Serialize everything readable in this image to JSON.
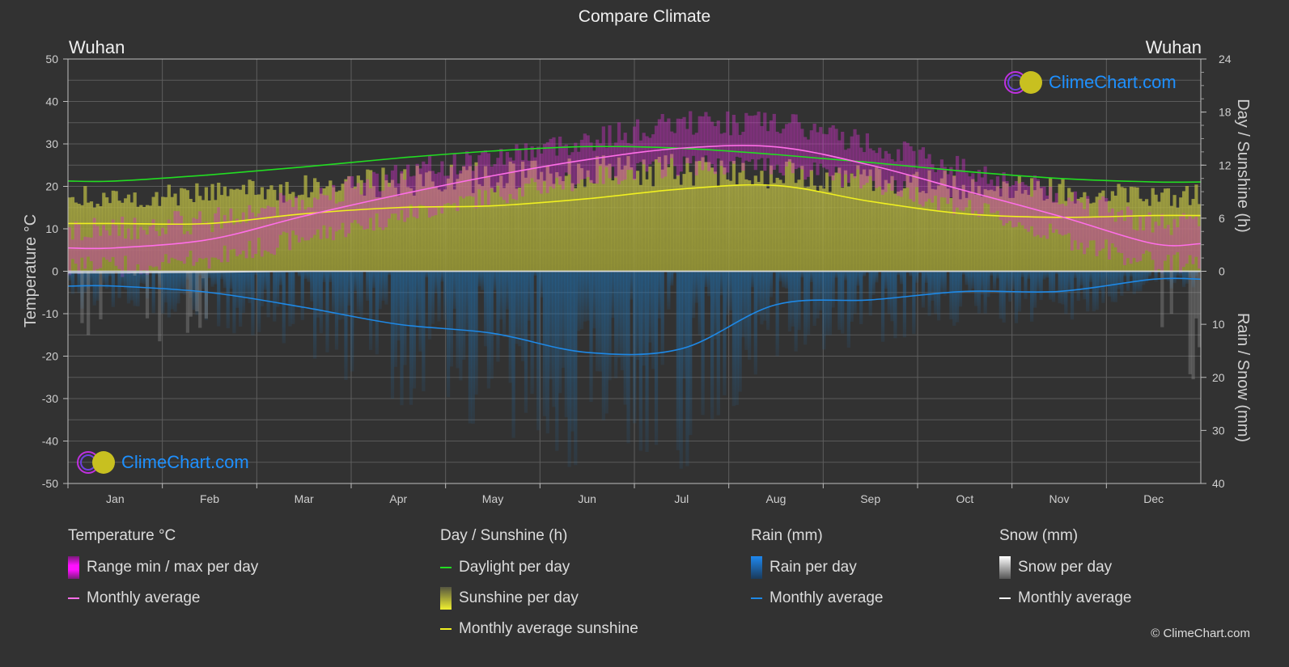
{
  "title": "Compare Climate",
  "city_left": "Wuhan",
  "city_right": "Wuhan",
  "logo_text": "ClimeChart.com",
  "copyright": "© ClimeChart.com",
  "colors": {
    "background": "#323232",
    "temperature_range": "#e020e0",
    "temperature_avg": "#ff6ee8",
    "daylight": "#22dd22",
    "sunshine_bar": "#c8c832",
    "sunshine_avg": "#f0f020",
    "rain_bar": "#1f6fae",
    "rain_avg": "#1e88e5",
    "snow_bar": "#9a9a9a",
    "snow_avg": "#ffffff",
    "logo_text": "#1e90ff"
  },
  "legend": {
    "temperature": {
      "title": "Temperature °C",
      "range": "Range min / max per day",
      "avg": "Monthly average"
    },
    "sunshine": {
      "title": "Day / Sunshine (h)",
      "daylight": "Daylight per day",
      "sunshine": "Sunshine per day",
      "avg": "Monthly average sunshine"
    },
    "rain": {
      "title": "Rain (mm)",
      "per_day": "Rain per day",
      "avg": "Monthly average"
    },
    "snow": {
      "title": "Snow (mm)",
      "per_day": "Snow per day",
      "avg": "Monthly average"
    }
  },
  "chart_data": {
    "type": "line",
    "title": "Compare Climate",
    "categories": [
      "Jan",
      "Feb",
      "Mar",
      "Apr",
      "May",
      "Jun",
      "Jul",
      "Aug",
      "Sep",
      "Oct",
      "Nov",
      "Dec"
    ],
    "left_axis": {
      "label": "Temperature °C",
      "range": [
        -50,
        50
      ],
      "ticks": [
        50,
        40,
        30,
        20,
        10,
        0,
        -10,
        -20,
        -30,
        -40,
        -50
      ]
    },
    "right_axis_top": {
      "label": "Day / Sunshine (h)",
      "range": [
        0,
        24
      ],
      "ticks": [
        24,
        18,
        12,
        6,
        0
      ]
    },
    "right_axis_bottom": {
      "label": "Rain / Snow (mm)",
      "range": [
        0,
        40
      ],
      "ticks": [
        0,
        10,
        20,
        30,
        40
      ]
    },
    "grid": true,
    "legend_position": "bottom",
    "series": [
      {
        "name": "Temperature monthly average",
        "axis": "temperature",
        "unit": "°C",
        "values": [
          5.5,
          7.5,
          13,
          18,
          22.5,
          26.3,
          29,
          29.3,
          25,
          19,
          13,
          6.5
        ]
      },
      {
        "name": "Temperature daily max (approx)",
        "axis": "temperature",
        "unit": "°C",
        "values": [
          10,
          12,
          17,
          23,
          27,
          31,
          35,
          35,
          30,
          24,
          18,
          11
        ]
      },
      {
        "name": "Temperature daily min (approx)",
        "axis": "temperature",
        "unit": "°C",
        "values": [
          1,
          3,
          8,
          13,
          18,
          22,
          25,
          25,
          21,
          15,
          8,
          2
        ]
      },
      {
        "name": "Daylight per day",
        "axis": "sunshine",
        "unit": "h",
        "values": [
          10.2,
          10.9,
          11.8,
          12.8,
          13.6,
          14.1,
          13.9,
          13.2,
          12.3,
          11.3,
          10.5,
          10.1
        ]
      },
      {
        "name": "Sunshine per day (approx)",
        "axis": "sunshine",
        "unit": "h",
        "values": [
          9.3,
          9.8,
          10.5,
          11.3,
          11.9,
          12.5,
          12.8,
          12.4,
          11.5,
          10.8,
          10.2,
          9.5
        ]
      },
      {
        "name": "Monthly average sunshine",
        "axis": "sunshine",
        "unit": "h",
        "values": [
          5.4,
          5.4,
          6.5,
          7.2,
          7.4,
          8.2,
          9.3,
          9.7,
          7.9,
          6.5,
          6.1,
          6.3
        ]
      },
      {
        "name": "Rain monthly average",
        "axis": "rain",
        "unit": "mm",
        "values": [
          2.8,
          4.0,
          6.8,
          10.0,
          11.7,
          15.3,
          14.6,
          6.3,
          5.4,
          3.8,
          3.8,
          1.5
        ]
      },
      {
        "name": "Snow monthly average",
        "axis": "rain",
        "unit": "mm",
        "values": [
          0.3,
          0.2,
          0,
          0,
          0,
          0,
          0,
          0,
          0,
          0,
          0,
          0
        ]
      }
    ]
  }
}
